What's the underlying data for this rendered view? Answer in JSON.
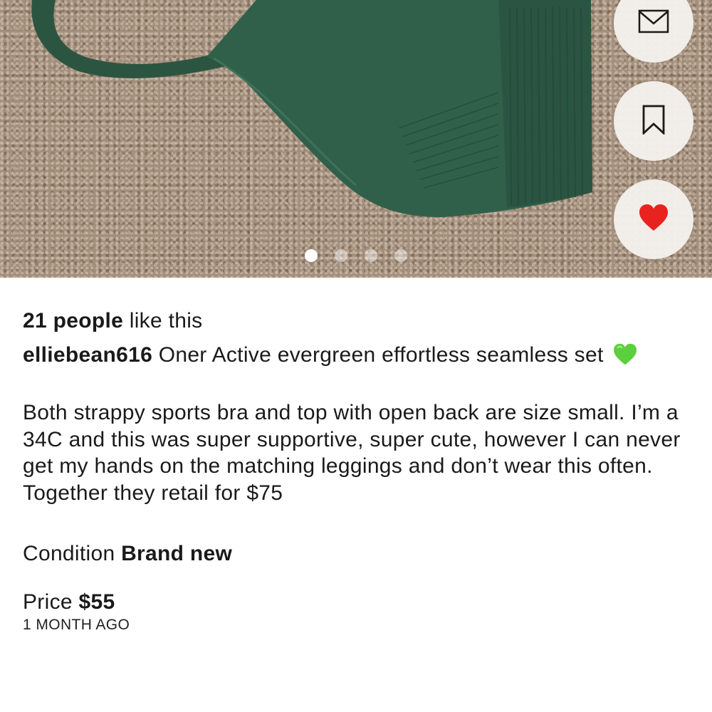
{
  "photo": {
    "carousel": {
      "total": 4,
      "active_index": 0
    },
    "actions": {
      "message_icon": "envelope-icon",
      "save_icon": "bookmark-icon",
      "like_icon": "heart-icon",
      "like_color": "#e8231f"
    }
  },
  "listing": {
    "likes_count": "21 people",
    "likes_suffix": "like this",
    "username": "elliebean616",
    "title": "Oner Active evergreen effortless seamless set",
    "title_emoji": "green-heart-icon",
    "description": "Both strappy sports bra and top with open back are size small. I’m a 34C and this was super supportive, super cute, however I can never get my hands on the matching leggings and don’t wear this often. Together they retail for $75",
    "condition_label": "Condition",
    "condition_value": "Brand new",
    "price_label": "Price",
    "price_value": "$55",
    "posted": "1 MONTH AGO"
  },
  "colors": {
    "garment_green": "#2f5a45",
    "carpet": "#a48f7c",
    "like_red": "#e8231f",
    "emoji_green": "#5ccf3c"
  }
}
